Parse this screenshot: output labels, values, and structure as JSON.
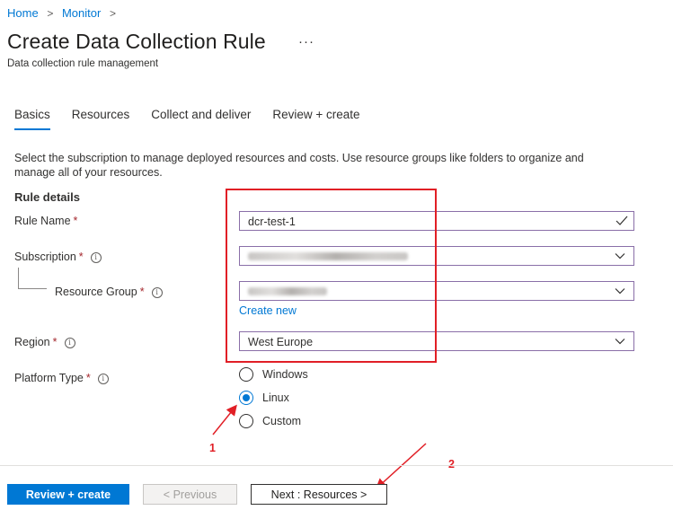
{
  "breadcrumb": {
    "items": [
      "Home",
      "Monitor"
    ]
  },
  "header": {
    "title": "Create Data Collection Rule",
    "more": "···",
    "subtitle": "Data collection rule management"
  },
  "tabs": [
    {
      "label": "Basics",
      "active": true
    },
    {
      "label": "Resources",
      "active": false
    },
    {
      "label": "Collect and deliver",
      "active": false
    },
    {
      "label": "Review + create",
      "active": false
    }
  ],
  "description": "Select the subscription to manage deployed resources and costs. Use resource groups like folders to organize and manage all of your resources.",
  "rule_details": {
    "heading": "Rule details",
    "rule_name": {
      "label": "Rule Name",
      "required": "*",
      "value": "dcr-test-1"
    },
    "subscription": {
      "label": "Subscription",
      "required": "*",
      "info": "i"
    },
    "resource_group": {
      "label": "Resource Group",
      "required": "*",
      "info": "i",
      "create_new": "Create new"
    },
    "region": {
      "label": "Region",
      "required": "*",
      "info": "i",
      "value": "West Europe"
    },
    "platform_type": {
      "label": "Platform Type",
      "required": "*",
      "info": "i",
      "options": [
        "Windows",
        "Linux",
        "Custom"
      ],
      "selected": "Linux"
    }
  },
  "footer": {
    "review_create": "Review + create",
    "previous": "< Previous",
    "next": "Next : Resources >"
  },
  "annotations": {
    "first": "1",
    "second": "2"
  },
  "colors": {
    "accent": "#0078d4",
    "annotation_red": "#e11f26",
    "required_red": "#a4262c"
  }
}
